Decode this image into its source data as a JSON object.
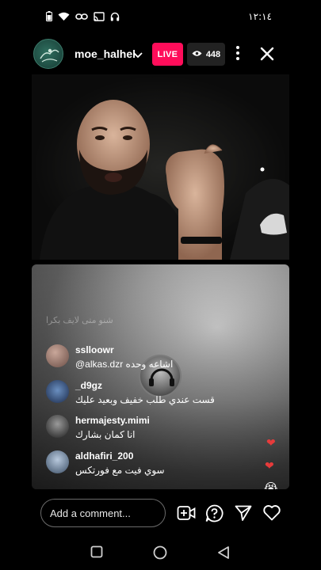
{
  "status_bar": {
    "time": "١٢:١٤",
    "icons": [
      "battery-icon",
      "wifi-icon",
      "link-icon",
      "cast-icon",
      "headphones-icon"
    ]
  },
  "header": {
    "username": "moe_halhel",
    "live_label": "LIVE",
    "viewer_count": "448",
    "icons": [
      "chevron-down-icon",
      "eye-icon",
      "more-vertical-icon",
      "close-icon"
    ]
  },
  "comments": {
    "faded": "شنو متى لايف بكرا",
    "items": [
      {
        "user": "sslloowr",
        "text": "@alkas.dzr اشاعه وحده"
      },
      {
        "user": "_d9gz",
        "text": "قست عندي طلب خفيف وبعيد عليك"
      },
      {
        "user": "hermajesty.mimi",
        "text": "انا كمان بشارك"
      },
      {
        "user": "aldhafiri_200",
        "text": "سوي فيت مع فورتكس"
      }
    ]
  },
  "reactions": [
    "heart",
    "heart",
    "crying-face",
    "heart"
  ],
  "bottom_bar": {
    "comment_placeholder": "Add a comment...",
    "icons": [
      "add-video-icon",
      "question-icon",
      "send-icon",
      "heart-icon"
    ]
  },
  "nav_bar": {
    "icons": [
      "recent-apps-icon",
      "home-icon",
      "back-icon"
    ]
  },
  "colors": {
    "live_badge": "#ff0d5a",
    "background": "#000000",
    "heart": "#e63b3b"
  }
}
